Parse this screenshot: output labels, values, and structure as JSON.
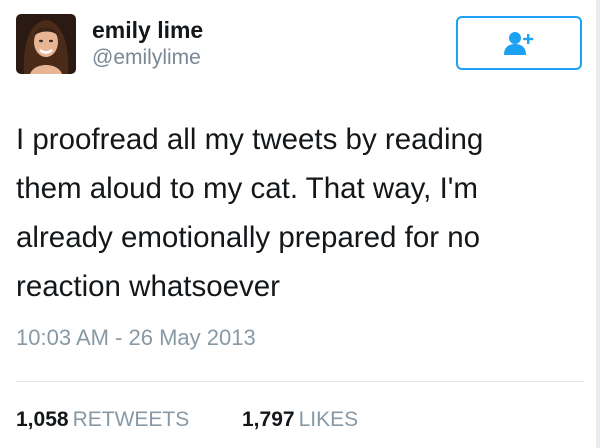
{
  "user": {
    "display_name": "emily lime",
    "handle": "@emilylime"
  },
  "follow_button": {
    "icon": "follow-user-plus-icon"
  },
  "tweet": {
    "lines": [
      "I proofread all my tweets by reading",
      "them aloud to my cat. That way, I'm",
      "already emotionally prepared for no",
      "reaction whatsoever"
    ],
    "timestamp": "10:03 AM - 26 May 2013"
  },
  "stats": {
    "retweets": {
      "count": "1,058",
      "label": "RETWEETS"
    },
    "likes": {
      "count": "1,797",
      "label": "LIKES"
    }
  },
  "colors": {
    "accent": "#1da1f2",
    "muted_text": "#8899a6",
    "primary_text": "#14171a"
  }
}
